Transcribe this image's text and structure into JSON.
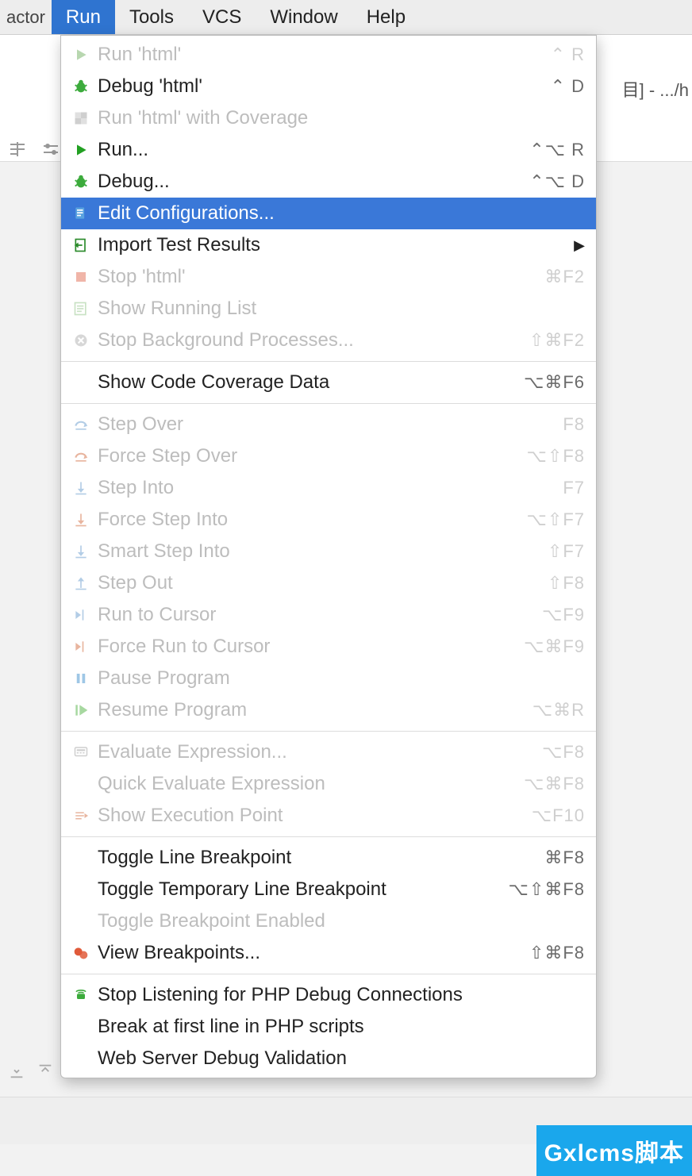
{
  "menubar": {
    "items": [
      "actor",
      "Run",
      "Tools",
      "VCS",
      "Window",
      "Help"
    ],
    "active_index": 1
  },
  "top_right_tab": "目] - .../h",
  "dropdown": {
    "groups": [
      [
        {
          "icon": "play",
          "iconColor": "#b8d7b0",
          "label": "Run 'html'",
          "shortcut": "⌃ R",
          "disabled": true
        },
        {
          "icon": "bug",
          "iconColor": "#3cab3c",
          "label": "Debug 'html'",
          "shortcut": "⌃ D",
          "disabled": false
        },
        {
          "icon": "coverage",
          "iconColor": "#cfcfcf",
          "label": "Run 'html' with Coverage",
          "shortcut": "",
          "disabled": true
        },
        {
          "icon": "play",
          "iconColor": "#22a022",
          "label": "Run...",
          "shortcut": "⌃⌥ R",
          "disabled": false
        },
        {
          "icon": "bug",
          "iconColor": "#3cab3c",
          "label": "Debug...",
          "shortcut": "⌃⌥ D",
          "disabled": false
        },
        {
          "icon": "edit",
          "iconColor": "#ffffff",
          "label": "Edit Configurations...",
          "shortcut": "",
          "disabled": false,
          "highlight": true
        },
        {
          "icon": "import",
          "iconColor": "#2a8a2a",
          "label": "Import Test Results",
          "shortcut": "",
          "submenu": true,
          "disabled": false
        },
        {
          "icon": "stop",
          "iconColor": "#f0b5a8",
          "label": "Stop 'html'",
          "shortcut": "⌘F2",
          "disabled": true
        },
        {
          "icon": "list",
          "iconColor": "#c9e2c4",
          "label": "Show Running List",
          "shortcut": "",
          "disabled": true
        },
        {
          "icon": "stopx",
          "iconColor": "#d7d7d7",
          "label": "Stop Background Processes...",
          "shortcut": "⇧⌘F2",
          "disabled": true
        }
      ],
      [
        {
          "icon": "",
          "label": "Show Code Coverage Data",
          "shortcut": "⌥⌘F6",
          "disabled": false
        }
      ],
      [
        {
          "icon": "stepover",
          "iconColor": "#b3cde6",
          "label": "Step Over",
          "shortcut": "F8",
          "disabled": true
        },
        {
          "icon": "stepover",
          "iconColor": "#e8b59f",
          "label": "Force Step Over",
          "shortcut": "⌥⇧F8",
          "disabled": true
        },
        {
          "icon": "stepinto",
          "iconColor": "#b3cde6",
          "label": "Step Into",
          "shortcut": "F7",
          "disabled": true
        },
        {
          "icon": "stepinto",
          "iconColor": "#e8b59f",
          "label": "Force Step Into",
          "shortcut": "⌥⇧F7",
          "disabled": true
        },
        {
          "icon": "stepinto",
          "iconColor": "#b3cde6",
          "label": "Smart Step Into",
          "shortcut": "⇧F7",
          "disabled": true
        },
        {
          "icon": "stepout",
          "iconColor": "#b3cde6",
          "label": "Step Out",
          "shortcut": "⇧F8",
          "disabled": true
        },
        {
          "icon": "cursor",
          "iconColor": "#b3cde6",
          "label": "Run to Cursor",
          "shortcut": "⌥F9",
          "disabled": true
        },
        {
          "icon": "cursor",
          "iconColor": "#e8b59f",
          "label": "Force Run to Cursor",
          "shortcut": "⌥⌘F9",
          "disabled": true
        },
        {
          "icon": "pause",
          "iconColor": "#9fc7e6",
          "label": "Pause Program",
          "shortcut": "",
          "disabled": true
        },
        {
          "icon": "resume",
          "iconColor": "#a7d8a0",
          "label": "Resume Program",
          "shortcut": "⌥⌘R",
          "disabled": true
        }
      ],
      [
        {
          "icon": "eval",
          "iconColor": "#cfcfcf",
          "label": "Evaluate Expression...",
          "shortcut": "⌥F8",
          "disabled": true
        },
        {
          "icon": "",
          "label": "Quick Evaluate Expression",
          "shortcut": "⌥⌘F8",
          "disabled": true
        },
        {
          "icon": "execpoint",
          "iconColor": "#e8b59f",
          "label": "Show Execution Point",
          "shortcut": "⌥F10",
          "disabled": true
        }
      ],
      [
        {
          "icon": "",
          "label": "Toggle Line Breakpoint",
          "shortcut": "⌘F8",
          "disabled": false
        },
        {
          "icon": "",
          "label": "Toggle Temporary Line Breakpoint",
          "shortcut": "⌥⇧⌘F8",
          "disabled": false
        },
        {
          "icon": "",
          "label": "Toggle Breakpoint Enabled",
          "shortcut": "",
          "disabled": true
        },
        {
          "icon": "breakpoints",
          "iconColor": "#e05a3a",
          "label": "View Breakpoints...",
          "shortcut": "⇧⌘F8",
          "disabled": false
        }
      ],
      [
        {
          "icon": "phone",
          "iconColor": "#3cab3c",
          "label": "Stop Listening for PHP Debug Connections",
          "shortcut": "",
          "disabled": false
        },
        {
          "icon": "",
          "label": "Break at first line in PHP scripts",
          "shortcut": "",
          "disabled": false
        },
        {
          "icon": "",
          "label": "Web Server Debug Validation",
          "shortcut": "",
          "disabled": false
        }
      ]
    ]
  },
  "watermark": "Gxlcms脚本"
}
